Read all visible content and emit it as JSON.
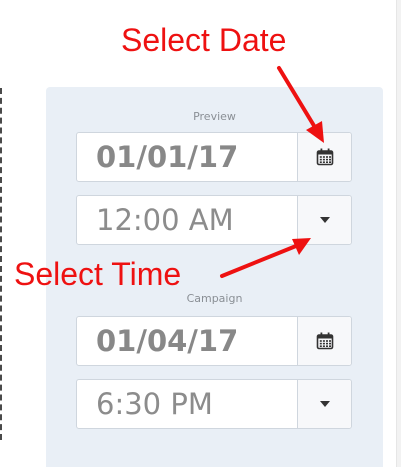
{
  "annotations": {
    "select_date": "Select Date",
    "select_time": "Select Time",
    "color": "#ee1111"
  },
  "preview": {
    "label": "Preview",
    "date": "01/01/17",
    "time": "12:00 AM",
    "date_icon": "calendar-icon",
    "time_icon": "caret-down-icon"
  },
  "campaign": {
    "label": "Campaign",
    "date": "01/04/17",
    "time": "6:30 PM",
    "date_icon": "calendar-icon",
    "time_icon": "caret-down-icon"
  },
  "colors": {
    "panel_bg": "#e9eff6",
    "field_border": "#cfd6de",
    "value_text": "#8c8c8c"
  }
}
